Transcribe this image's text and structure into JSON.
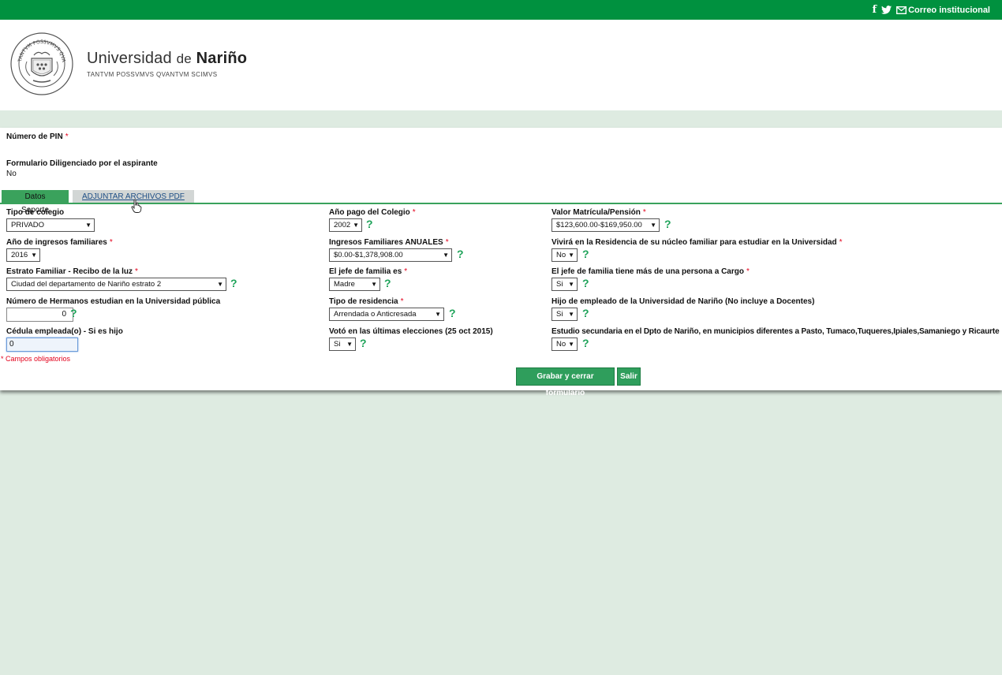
{
  "topbar": {
    "facebook_icon": "f",
    "twitter_icon": "twitter-bird",
    "mail_icon": "envelope",
    "mail_label": "Correo institucional"
  },
  "header": {
    "brand_first": "Universidad",
    "brand_de": "de",
    "brand_last": "Nariño",
    "motto": "TANTVM POSSVMVS QVANTVM SCIMVS"
  },
  "form": {
    "pin_label": "Número de PIN",
    "diligenciado_label": "Formulario Diligenciado por el aspirante",
    "diligenciado_value": "No",
    "required_mark": "*",
    "tabs": {
      "active": "Datos Soporte",
      "inactive": "ADJUNTAR ARCHIVOS PDF"
    },
    "help_icon": "?",
    "dropdown_arrow": "▼",
    "col1": {
      "tipo_colegio_label": "Tipo de colegio",
      "tipo_colegio_value": "PRIVADO",
      "anio_ingresos_label": "Año de ingresos familiares",
      "anio_ingresos_value": "2016",
      "estrato_label": "Estrato Familiar - Recibo de la luz",
      "estrato_value": "Ciudad del departamento de Nariño estrato 2",
      "hermanos_label": "Número de Hermanos estudian en la Universidad pública",
      "hermanos_value": "0",
      "cedula_label": "Cédula empleada(o) - Si es hijo",
      "cedula_value": "0"
    },
    "col2": {
      "anio_pago_label": "Año pago del Colegio",
      "anio_pago_value": "2002",
      "ingresos_label": "Ingresos Familiares ANUALES",
      "ingresos_value": "$0.00-$1,378,908.00",
      "jefe_label": "El jefe de familia es",
      "jefe_value": "Madre",
      "residencia_label": "Tipo de residencia",
      "residencia_value": "Arrendada o Anticresada",
      "voto_label": "Votó en las últimas elecciones (25 oct 2015)",
      "voto_value": "Si"
    },
    "col3": {
      "valor_label": "Valor Matrícula/Pensión",
      "valor_value": "$123,600.00-$169,950.00",
      "vivira_label": "Vivirá en la Residencia de su núcleo familiar para estudiar en la Universidad",
      "vivira_value": "No",
      "cargo_label": "El jefe de familia tiene más de una persona a Cargo",
      "cargo_value": "Si",
      "hijo_label": "Hijo de empleado de la Universidad de Nariño (No incluye a Docentes)",
      "hijo_value": "Si",
      "secundaria_label": "Estudio secundaria en el Dpto de Nariño, en municipios diferentes a Pasto, Tumaco,Tuqueres,Ipiales,Samaniego y Ricaurte",
      "secundaria_value": "No"
    },
    "obligatorios": "* Campos obligatorios",
    "save_button": "Grabar y cerrar formulario",
    "exit_button": "Salir"
  }
}
